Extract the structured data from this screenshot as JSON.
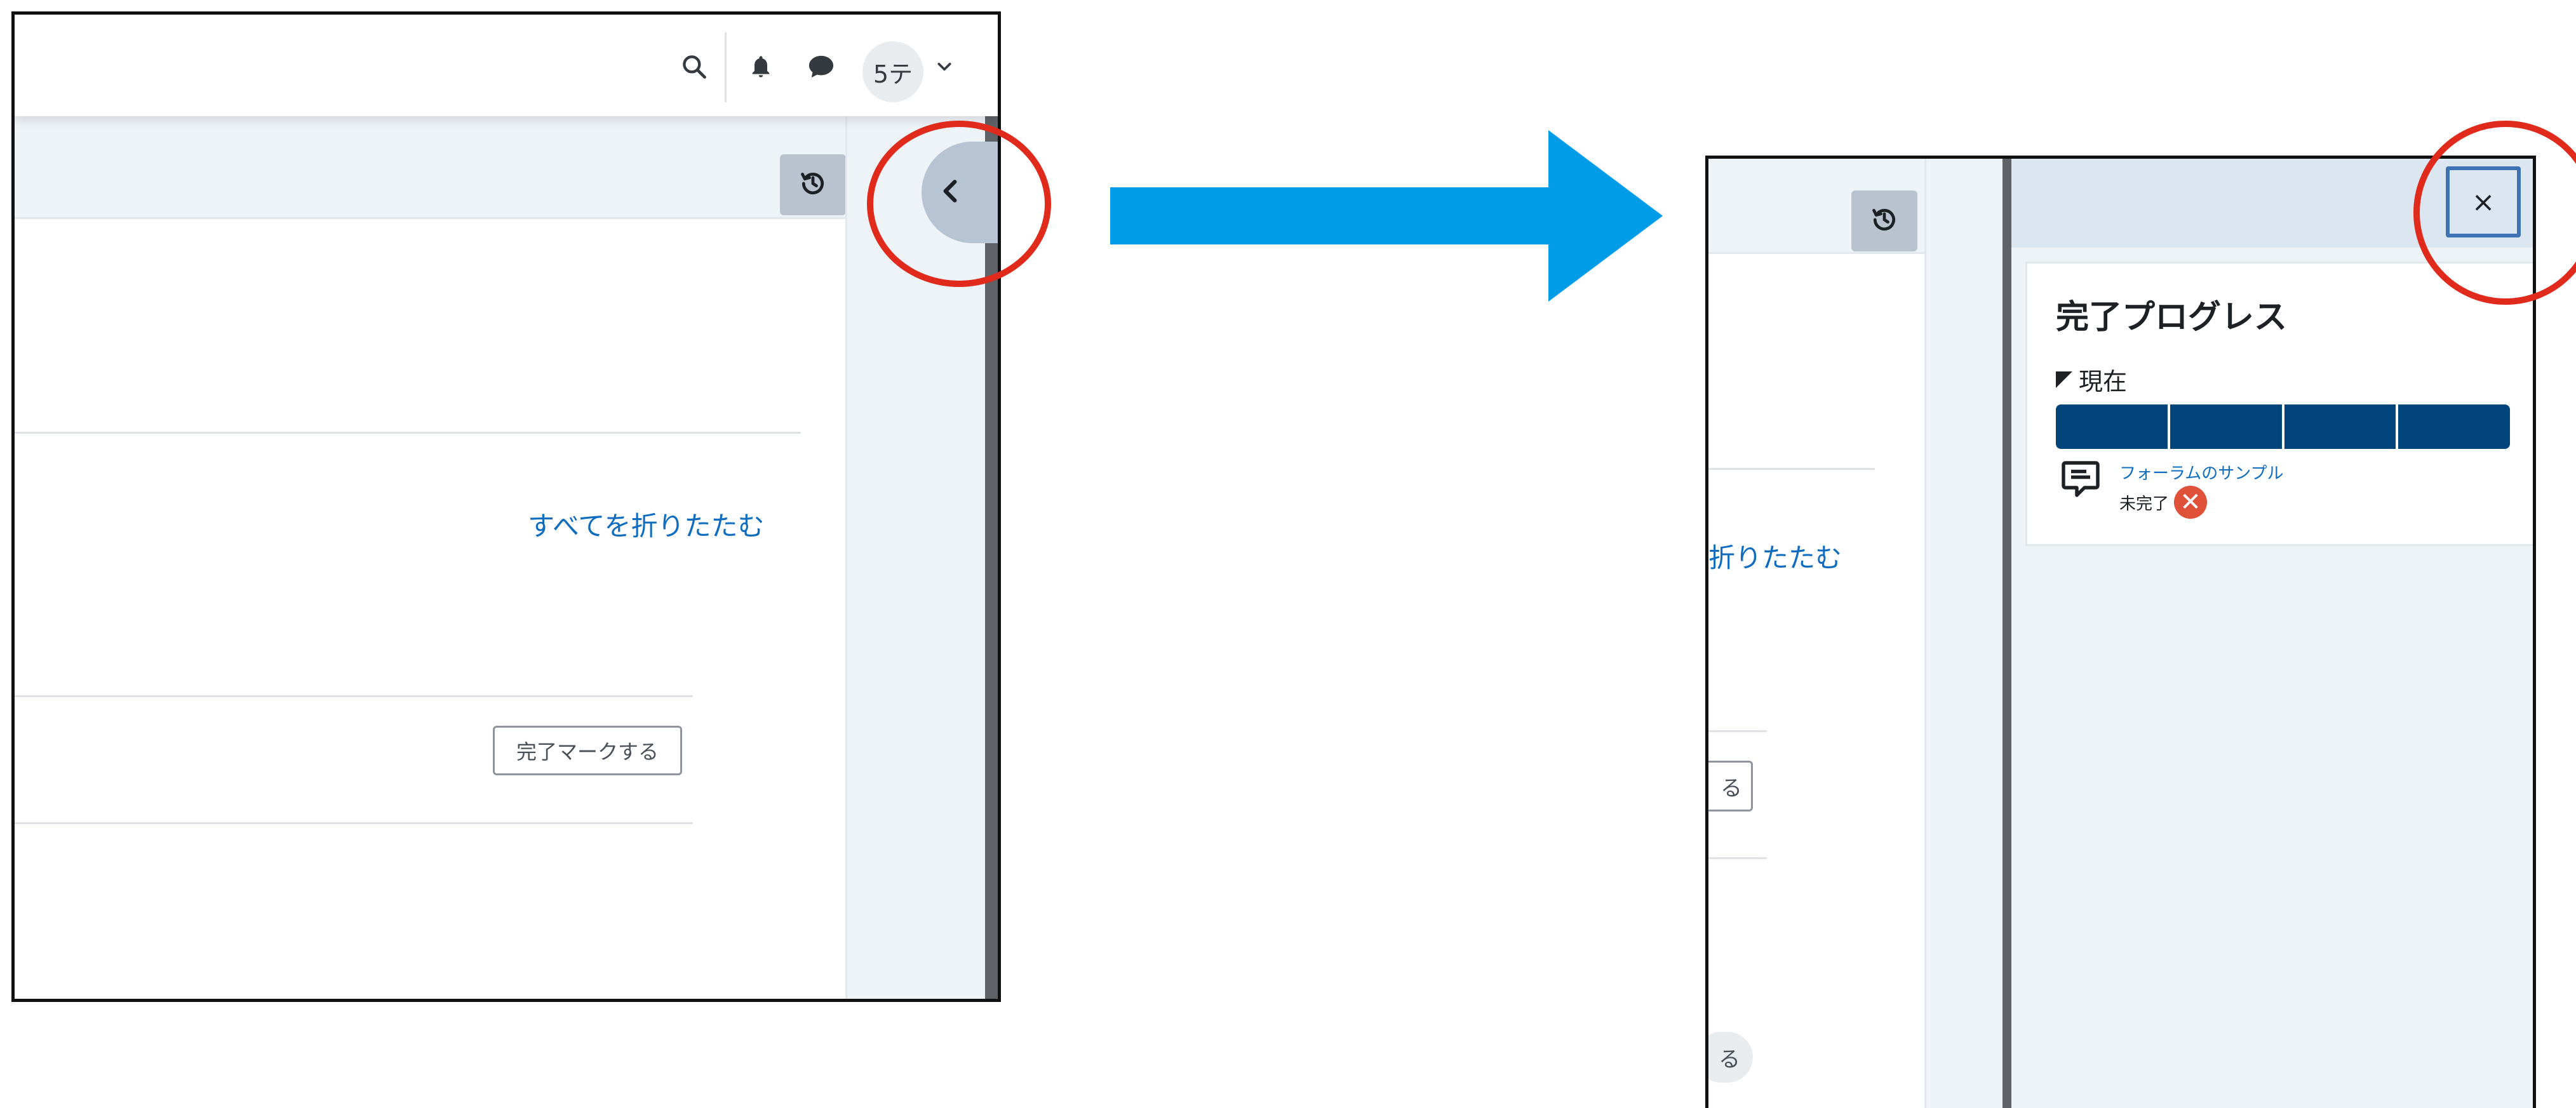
{
  "colors": {
    "annotation_circle": "#e02a1c",
    "arrow": "#009ce8",
    "link": "#0f6cbf",
    "progress_bar": "#00447c",
    "incomplete_badge": "#e0513a",
    "drawer_close_border": "#3d72b4"
  },
  "before": {
    "navbar": {
      "icons": [
        "search-icon",
        "bell-icon",
        "chat-icon"
      ],
      "avatar_text": "5テ",
      "avatar_dropdown_icon": "chevron-down-icon"
    },
    "history_icon": "history-icon",
    "drawer_toggle_icon": "chevron-left-icon",
    "collapse_all_link": "すべてを折りたたむ",
    "mark_done_button": "完了マークする"
  },
  "after": {
    "history_icon": "history-icon",
    "collapse_all_partial": "折りたたむ",
    "mark_done_partial": "る",
    "pill_partial": "る",
    "drawer": {
      "close_label": "×",
      "block_title": "完了プログレス",
      "current_label": "現在",
      "progress_segments": 4,
      "activity_icon": "forum-icon",
      "activity_name": "フォーラムのサンプル",
      "activity_status": "未完了",
      "status_icon": "x-circle-icon"
    }
  }
}
